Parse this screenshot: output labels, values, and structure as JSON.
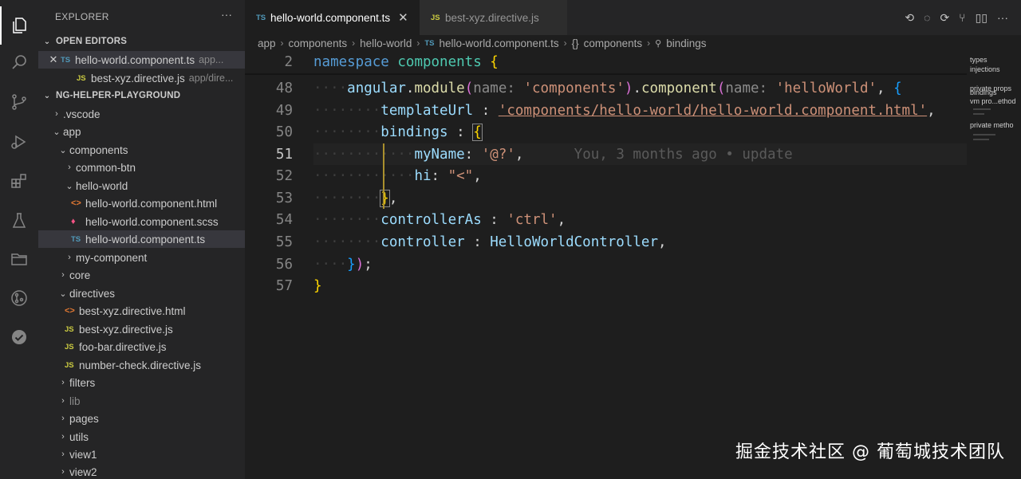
{
  "activity_bar": {
    "icons": [
      "files-icon",
      "search-icon",
      "source-control-icon",
      "run-debug-icon",
      "extensions-icon",
      "testing-icon",
      "folder-icon",
      "git-lens-icon",
      "checkmark-icon"
    ]
  },
  "sidebar": {
    "title": "EXPLORER",
    "more": "···",
    "open_editors": {
      "header": "OPEN EDITORS",
      "items": [
        {
          "badge": "TS",
          "name": "hello-world.component.ts",
          "desc": "app..."
        },
        {
          "badge": "JS",
          "name": "best-xyz.directive.js",
          "desc": "app/dire..."
        }
      ]
    },
    "workspace": {
      "header": "NG-HELPER-PLAYGROUND",
      "items": [
        {
          "name": ".vscode",
          "chev": "›"
        },
        {
          "name": "app",
          "chev": "⌄"
        },
        {
          "name": "components",
          "chev": "⌄"
        },
        {
          "name": "common-btn",
          "chev": "›"
        },
        {
          "name": "hello-world",
          "chev": "⌄"
        },
        {
          "name": "hello-world.component.html",
          "badge": "<>"
        },
        {
          "name": "hello-world.component.scss",
          "badge": "♦"
        },
        {
          "name": "hello-world.component.ts",
          "badge": "TS"
        },
        {
          "name": "my-component",
          "chev": "›"
        },
        {
          "name": "core",
          "chev": "›"
        },
        {
          "name": "directives",
          "chev": "⌄"
        },
        {
          "name": "best-xyz.directive.html",
          "badge": "<>"
        },
        {
          "name": "best-xyz.directive.js",
          "badge": "JS"
        },
        {
          "name": "foo-bar.directive.js",
          "badge": "JS"
        },
        {
          "name": "number-check.directive.js",
          "badge": "JS"
        },
        {
          "name": "filters",
          "chev": "›"
        },
        {
          "name": "lib",
          "chev": "›"
        },
        {
          "name": "pages",
          "chev": "›"
        },
        {
          "name": "utils",
          "chev": "›"
        },
        {
          "name": "view1",
          "chev": "›"
        },
        {
          "name": "view2",
          "chev": "›"
        }
      ]
    }
  },
  "tabs": [
    {
      "badge": "TS",
      "label": "hello-world.component.ts",
      "close": "✕"
    },
    {
      "badge": "JS",
      "label": "best-xyz.directive.js"
    }
  ],
  "breadcrumb": [
    "app",
    "components",
    "hello-world",
    "hello-world.component.ts",
    "components",
    "bindings"
  ],
  "breadcrumb_icons": {
    "ts": "TS",
    "ns": "{}",
    "wrench": "🔧"
  },
  "editor": {
    "line_numbers": [
      "2",
      "48",
      "49",
      "50",
      "51",
      "52",
      "53",
      "54",
      "55",
      "56",
      "57"
    ],
    "lines": {
      "l2_kw": "namespace",
      "l2_name": "components",
      "l48_obj": "angular",
      "l48_fn": "module",
      "l48_hint": "name:",
      "l48_str": "'components'",
      "l48_fn2": "component",
      "l48_hint2": "name:",
      "l48_str2": "'helloWorld'",
      "l49_prop": "templateUrl",
      "l49_str": "'components/hello-world/hello-world.component.html'",
      "l50_prop": "bindings",
      "l51_prop": "myName",
      "l51_str": "'@?'",
      "l51_blame": "You, 3 months ago • update",
      "l52_prop": "hi",
      "l52_str": "\"<\"",
      "l54_prop": "controllerAs",
      "l54_str": "'ctrl'",
      "l55_prop": "controller",
      "l55_val": "HelloWorldController"
    }
  },
  "minimap": {
    "labels": [
      "types",
      "injections",
      "private props",
      "bindings",
      "vm pro...ethod",
      "private metho"
    ]
  },
  "watermark": "掘金技术社区 @ 葡萄城技术团队"
}
